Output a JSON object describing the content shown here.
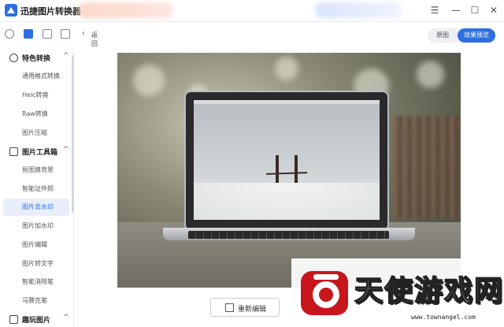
{
  "app": {
    "title": "迅捷图片转换器"
  },
  "window_controls": {
    "menu": "☰",
    "minimize": "—",
    "maximize": "☐",
    "close": "✕"
  },
  "sidebar": {
    "sections": [
      {
        "label": "特色转换",
        "icon": "convert-icon",
        "items": [
          "通用格式转换",
          "Heic转换",
          "Raw转换",
          "图片压缩"
        ]
      },
      {
        "label": "图片工具箱",
        "icon": "toolbox-icon",
        "items": [
          "抠图换背景",
          "智能证件照",
          "图片去水印",
          "图片加水印",
          "图片编辑",
          "图片转文字",
          "智能消除笔",
          "马赛克笔"
        ]
      },
      {
        "label": "趣玩图片",
        "icon": "fun-image-icon",
        "items": []
      }
    ],
    "active_item": "图片去水印"
  },
  "header": {
    "back_label": "返回",
    "view_toggle": {
      "original": "原图",
      "preview": "效果预览",
      "selected": "效果预览"
    }
  },
  "actions": {
    "re_edit_label": "重新编辑"
  },
  "watermark": {
    "text": "天使游戏网",
    "url": "www.townangel.com"
  },
  "colors": {
    "accent": "#2d6fe0",
    "active_bg": "#e8eefb"
  }
}
